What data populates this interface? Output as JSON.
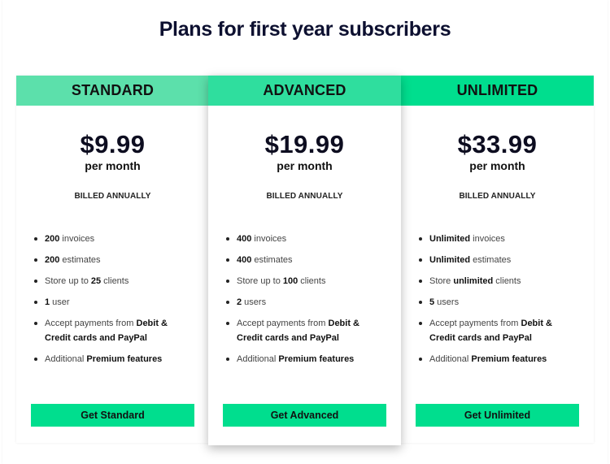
{
  "page": {
    "title": "Plans for first year subscribers"
  },
  "plans": [
    {
      "name": "STANDARD",
      "header_color": "#5ce0ab",
      "price": "$9.99",
      "period": "per month",
      "billing": "BILLED ANNUALLY",
      "features": [
        [
          {
            "t": "200",
            "b": true
          },
          {
            "t": " invoices",
            "b": false
          }
        ],
        [
          {
            "t": "200",
            "b": true
          },
          {
            "t": " estimates",
            "b": false
          }
        ],
        [
          {
            "t": "Store up to ",
            "b": false
          },
          {
            "t": "25",
            "b": true
          },
          {
            "t": " clients",
            "b": false
          }
        ],
        [
          {
            "t": "1",
            "b": true
          },
          {
            "t": " user",
            "b": false
          }
        ],
        [
          {
            "t": "Accept payments from ",
            "b": false
          },
          {
            "t": "Debit & Credit cards and PayPal",
            "b": true
          }
        ],
        [
          {
            "t": "Additional ",
            "b": false
          },
          {
            "t": "Premium features",
            "b": true
          }
        ]
      ],
      "cta": "Get Standard"
    },
    {
      "name": "ADVANCED",
      "header_color": "#2fde9e",
      "price": "$19.99",
      "period": "per month",
      "billing": "BILLED ANNUALLY",
      "features": [
        [
          {
            "t": "400",
            "b": true
          },
          {
            "t": " invoices",
            "b": false
          }
        ],
        [
          {
            "t": "400",
            "b": true
          },
          {
            "t": " estimates",
            "b": false
          }
        ],
        [
          {
            "t": "Store up to ",
            "b": false
          },
          {
            "t": "100",
            "b": true
          },
          {
            "t": " clients",
            "b": false
          }
        ],
        [
          {
            "t": "2",
            "b": true
          },
          {
            "t": " users",
            "b": false
          }
        ],
        [
          {
            "t": "Accept payments from ",
            "b": false
          },
          {
            "t": "Debit & Credit cards and PayPal",
            "b": true
          }
        ],
        [
          {
            "t": "Additional ",
            "b": false
          },
          {
            "t": "Premium features",
            "b": true
          }
        ]
      ],
      "cta": "Get Advanced"
    },
    {
      "name": "UNLIMITED",
      "header_color": "#00de8e",
      "price": "$33.99",
      "period": "per month",
      "billing": "BILLED ANNUALLY",
      "features": [
        [
          {
            "t": "Unlimited",
            "b": true
          },
          {
            "t": " invoices",
            "b": false
          }
        ],
        [
          {
            "t": "Unlimited",
            "b": true
          },
          {
            "t": " estimates",
            "b": false
          }
        ],
        [
          {
            "t": "Store ",
            "b": false
          },
          {
            "t": "unlimited",
            "b": true
          },
          {
            "t": " clients",
            "b": false
          }
        ],
        [
          {
            "t": "5",
            "b": true
          },
          {
            "t": " users",
            "b": false
          }
        ],
        [
          {
            "t": "Accept payments from ",
            "b": false
          },
          {
            "t": "Debit & Credit cards and PayPal",
            "b": true
          }
        ],
        [
          {
            "t": "Additional ",
            "b": false
          },
          {
            "t": "Premium features",
            "b": true
          }
        ]
      ],
      "cta": "Get Unlimited"
    }
  ],
  "colors": {
    "cta": "#00de8e",
    "title": "#0d1030"
  }
}
